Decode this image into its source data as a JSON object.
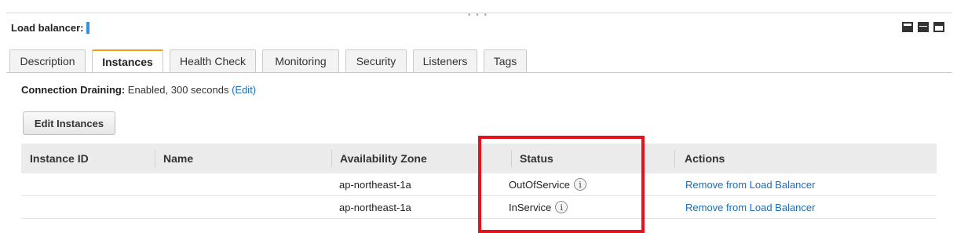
{
  "header": {
    "title": "Load balancer:"
  },
  "tabs": [
    {
      "label": "Description",
      "active": false
    },
    {
      "label": "Instances",
      "active": true
    },
    {
      "label": "Health Check",
      "active": false
    },
    {
      "label": "Monitoring",
      "active": false
    },
    {
      "label": "Security",
      "active": false
    },
    {
      "label": "Listeners",
      "active": false
    },
    {
      "label": "Tags",
      "active": false
    }
  ],
  "connection_draining": {
    "label": "Connection Draining:",
    "value": "Enabled, 300 seconds",
    "edit_label": "(Edit)"
  },
  "edit_instances_label": "Edit Instances",
  "table": {
    "columns": [
      "Instance ID",
      "Name",
      "Availability Zone",
      "Status",
      "Actions"
    ],
    "rows": [
      {
        "instance_id": "",
        "name": "",
        "zone": "ap-northeast-1a",
        "status": "OutOfService",
        "action": "Remove from Load Balancer"
      },
      {
        "instance_id": "",
        "name": "",
        "zone": "ap-northeast-1a",
        "status": "InService",
        "action": "Remove from Load Balancer"
      }
    ]
  },
  "colors": {
    "highlight": "#e8111b",
    "link": "#1a6eb8",
    "active_tab_accent": "#f29d1d"
  },
  "icons": [
    "info-icon",
    "view-mode-icon"
  ]
}
